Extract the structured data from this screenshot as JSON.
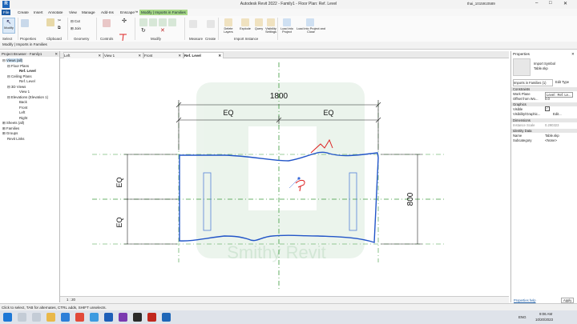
{
  "window": {
    "title": "Autodesk Revit 2022 - Family1 - Floor Plan: Ref. Level",
    "user": "thai_1015910589"
  },
  "menu": {
    "tabs": [
      "File",
      "Create",
      "Insert",
      "Annotate",
      "View",
      "Manage",
      "Add-Ins",
      "Enscape™",
      "Modify | Imports in Families"
    ]
  },
  "ribbon": {
    "groups": [
      "Select",
      "Properties",
      "Clipboard",
      "Geometry",
      "Controls",
      "Modify",
      "Measure",
      "Create",
      "Import Instance",
      "Family Editor"
    ],
    "modify_button": "Modify",
    "cut_label": "Cut",
    "join_label": "Join",
    "activate_label": "Activate",
    "delete_layers": "Delete Layers",
    "explode": "Explode",
    "query": "Query",
    "visibility_settings": "Visibility Settings",
    "load_into_project": "Load into Project",
    "load_into_project_close": "Load into Project and Close"
  },
  "options_bar": {
    "text": "Modify | Imports in Families"
  },
  "project_browser": {
    "title": "Project Browser - Family1",
    "nodes": {
      "views": "Views (all)",
      "floor_plans": "Floor Plans",
      "ref_level": "Ref. Level",
      "ceiling_plans": "Ceiling Plans",
      "ceiling_ref": "Ref. Level",
      "views_3d": "3D Views",
      "view1": "View 1",
      "elevations": "Elevations (Elevation 1)",
      "back": "Back",
      "front": "Front",
      "left": "Left",
      "right": "Right",
      "sheets": "Sheets (all)",
      "families": "Families",
      "groups": "Groups",
      "links": "Revit Links"
    }
  },
  "view_tabs": [
    "Left",
    "View 1",
    "Front",
    "Ref. Level"
  ],
  "drawing": {
    "dim_total": "1800",
    "dim_eq1": "EQ",
    "dim_eq2": "EQ",
    "dim_eq3": "EQ",
    "dim_eq4": "EQ",
    "dim_side": "800",
    "watermark": "Smithy Revit"
  },
  "properties": {
    "title": "Properties",
    "type_name": "Import Symbol",
    "type_sub": "Table.skp",
    "selector": "Imports in Families (1)",
    "edit_type": "Edit Type",
    "sections": {
      "constraints": "Constraints",
      "graphics": "Graphics",
      "dimensions": "Dimensions",
      "identity": "Identity Data"
    },
    "rows": {
      "work_plane_k": "Work Plane",
      "work_plane_v": "Level : Ref. Le...",
      "offset_k": "Offset from Wo...",
      "offset_v": "0.0",
      "visible_k": "Visible",
      "vis_graphics_k": "Visibility/Graphic...",
      "vis_graphics_v": "Edit...",
      "scale_k": "Instance Scale",
      "scale_v": "0.290323",
      "name_k": "Name",
      "name_v": "Table.skp",
      "subcat_k": "Subcategory",
      "subcat_v": "<None>"
    },
    "help": "Properties help",
    "apply": "Apply"
  },
  "view_control": {
    "scale": "1 : 20"
  },
  "status": {
    "text": "Click to select, TAB for alternates, CTRL adds, SHIFT unselects."
  },
  "taskbar": {
    "lang": "ENG",
    "time": "9:06 AM",
    "date": "10/20/2023"
  }
}
